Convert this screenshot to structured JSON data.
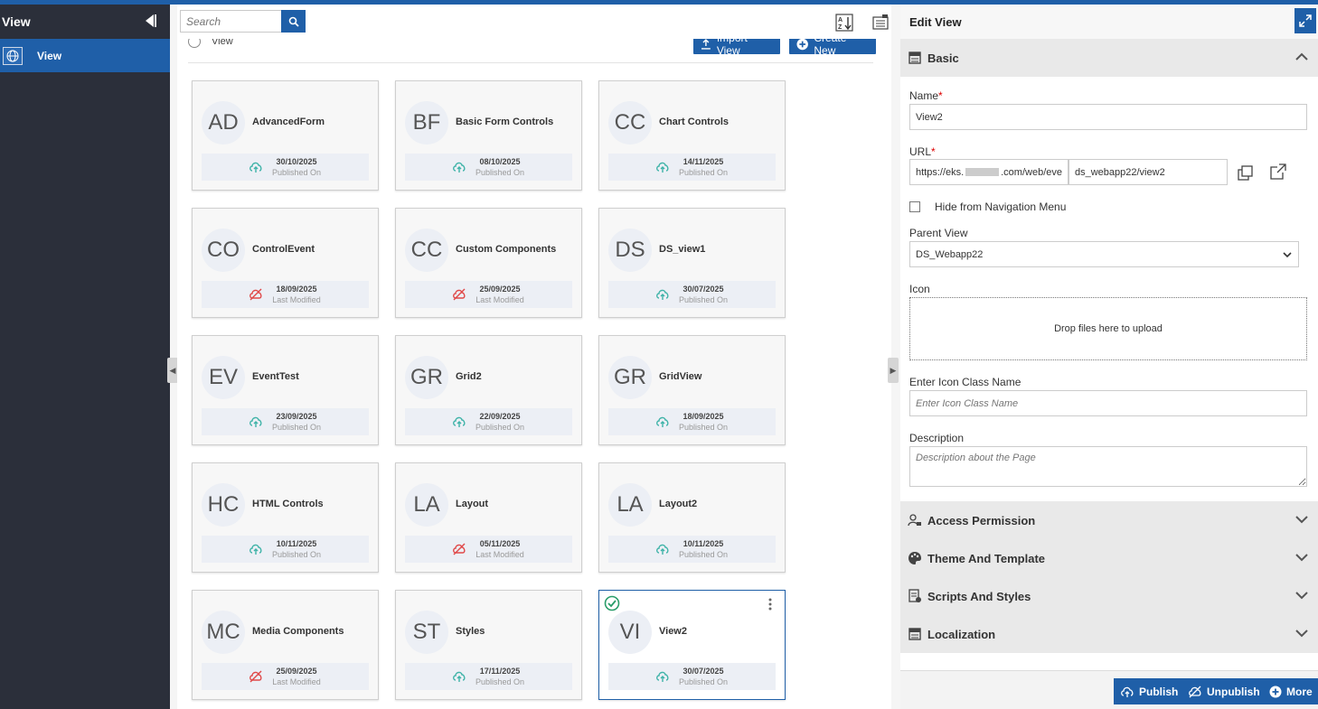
{
  "sidebar": {
    "title": "View",
    "items": [
      {
        "label": "View"
      }
    ]
  },
  "toolbar": {
    "search_placeholder": "Search"
  },
  "content": {
    "breadcrumb": "View",
    "import_label": "Import View",
    "create_label": "Create New",
    "cards": [
      {
        "initials": "AD",
        "title": "AdvancedForm",
        "date": "30/10/2025",
        "status": "Published On",
        "state": "published"
      },
      {
        "initials": "BF",
        "title": "Basic Form Controls",
        "date": "08/10/2025",
        "status": "Published On",
        "state": "published"
      },
      {
        "initials": "CC",
        "title": "Chart Controls",
        "date": "14/11/2025",
        "status": "Published On",
        "state": "published"
      },
      {
        "initials": "CO",
        "title": "ControlEvent",
        "date": "18/09/2025",
        "status": "Last Modified",
        "state": "modified"
      },
      {
        "initials": "CC",
        "title": "Custom Components",
        "date": "25/09/2025",
        "status": "Last Modified",
        "state": "modified"
      },
      {
        "initials": "DS",
        "title": "DS_view1",
        "date": "30/07/2025",
        "status": "Published On",
        "state": "published"
      },
      {
        "initials": "EV",
        "title": "EventTest",
        "date": "23/09/2025",
        "status": "Published On",
        "state": "published"
      },
      {
        "initials": "GR",
        "title": "Grid2",
        "date": "22/09/2025",
        "status": "Published On",
        "state": "published"
      },
      {
        "initials": "GR",
        "title": "GridView",
        "date": "18/09/2025",
        "status": "Published On",
        "state": "published"
      },
      {
        "initials": "HC",
        "title": "HTML Controls",
        "date": "10/11/2025",
        "status": "Published On",
        "state": "published"
      },
      {
        "initials": "LA",
        "title": "Layout",
        "date": "05/11/2025",
        "status": "Last Modified",
        "state": "modified"
      },
      {
        "initials": "LA",
        "title": "Layout2",
        "date": "10/11/2025",
        "status": "Published On",
        "state": "published"
      },
      {
        "initials": "MC",
        "title": "Media Components",
        "date": "25/09/2025",
        "status": "Last Modified",
        "state": "modified"
      },
      {
        "initials": "ST",
        "title": "Styles",
        "date": "17/11/2025",
        "status": "Published On",
        "state": "published"
      },
      {
        "initials": "VI",
        "title": "View2",
        "date": "30/07/2025",
        "status": "Published On",
        "state": "published",
        "selected": true
      }
    ]
  },
  "panel": {
    "title": "Edit View",
    "basic": {
      "title": "Basic",
      "name_label": "Name",
      "name_value": "View2",
      "url_label": "URL",
      "url_base": "https://eks.",
      "url_suffix": ".com/web/eve",
      "url_path": "ds_webapp22/view2",
      "hide_nav_label": "Hide from Navigation Menu",
      "parent_label": "Parent View",
      "parent_value": "DS_Webapp22",
      "icon_label": "Icon",
      "drop_text": "Drop files here to upload",
      "icon_class_label": "Enter Icon Class Name",
      "icon_class_placeholder": "Enter Icon Class Name",
      "desc_label": "Description",
      "desc_placeholder": "Description about the Page"
    },
    "sections": [
      {
        "title": "Access Permission"
      },
      {
        "title": "Theme And Template"
      },
      {
        "title": "Scripts And Styles"
      },
      {
        "title": "Localization"
      }
    ],
    "footer": {
      "publish": "Publish",
      "unpublish": "Unpublish",
      "more": "More"
    }
  },
  "colors": {
    "brand": "#1f5fa8",
    "published_icon": "#3fb3a8",
    "modified_icon": "#e04848",
    "selected_check": "#2a9d6a"
  }
}
